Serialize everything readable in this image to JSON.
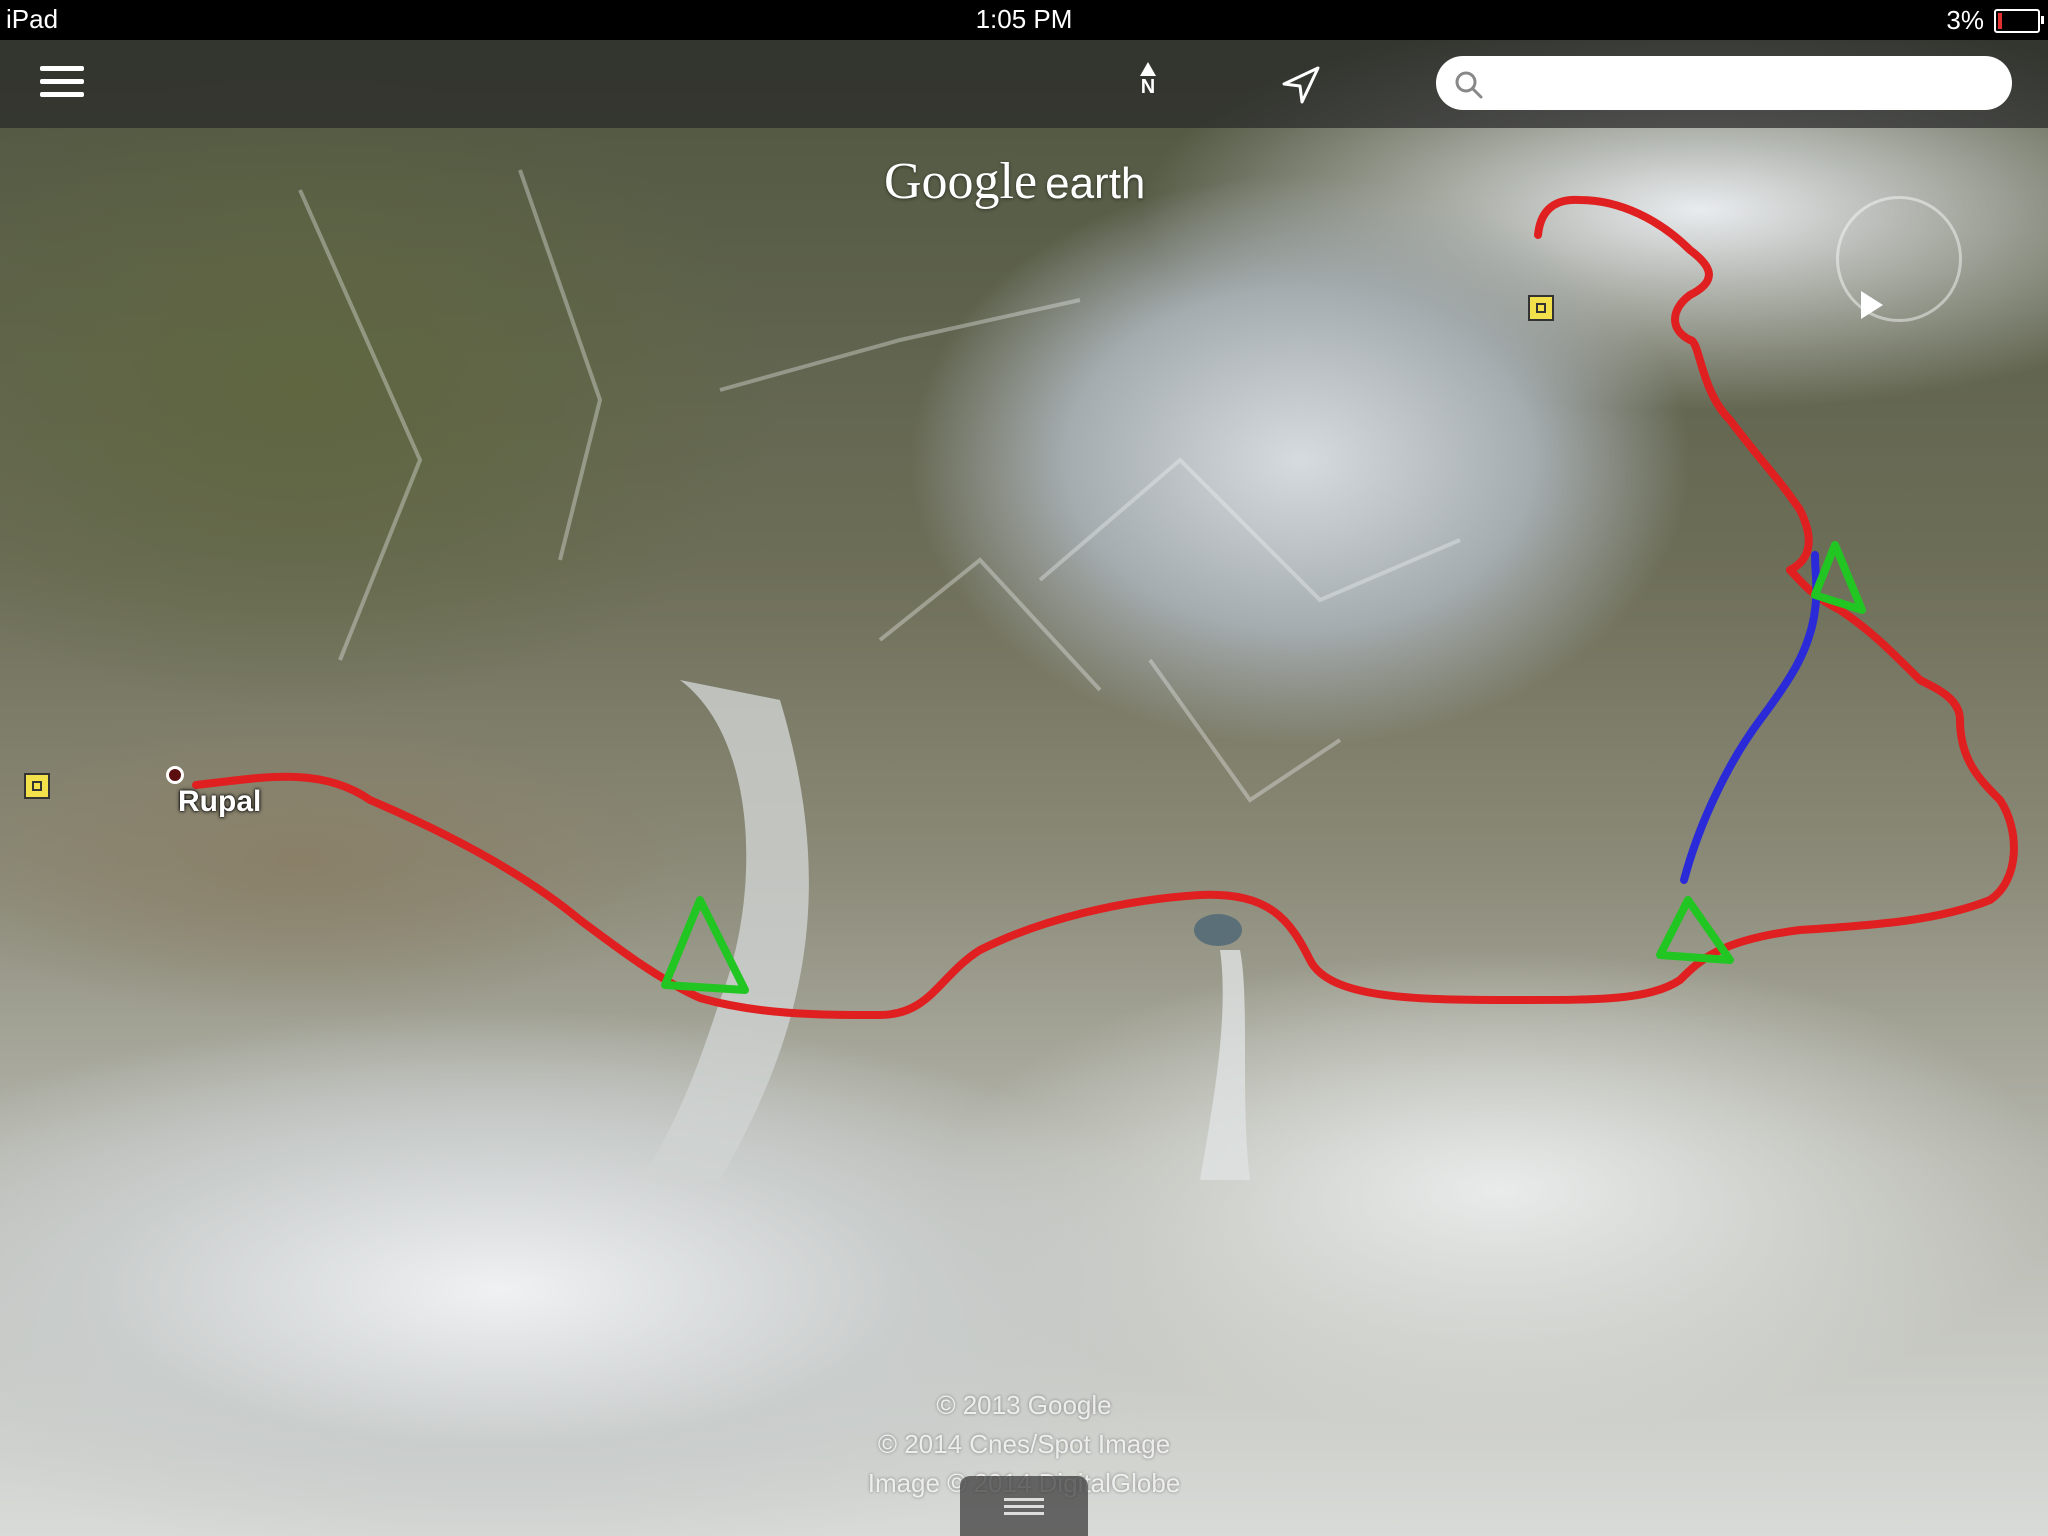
{
  "status_bar": {
    "device": "iPad",
    "time": "1:05 PM",
    "battery_percent": "3%"
  },
  "toolbar": {
    "menu_icon": "hamburger-menu-icon",
    "compass_label": "N",
    "location_icon": "location-arrow-icon",
    "search_placeholder": ""
  },
  "logo": {
    "google": "Google",
    "earth": "earth"
  },
  "map": {
    "place_label": "Rupal",
    "route_color": "#e02020",
    "alt_route_color": "#2a2ad8",
    "camp_marker_color": "#22c622",
    "placemark_color": "#f2e14a"
  },
  "copyright": {
    "line1": "© 2013 Google",
    "line2": "© 2014 Cnes/Spot Image",
    "line3": "Image © 2014 DigitalGlobe"
  }
}
